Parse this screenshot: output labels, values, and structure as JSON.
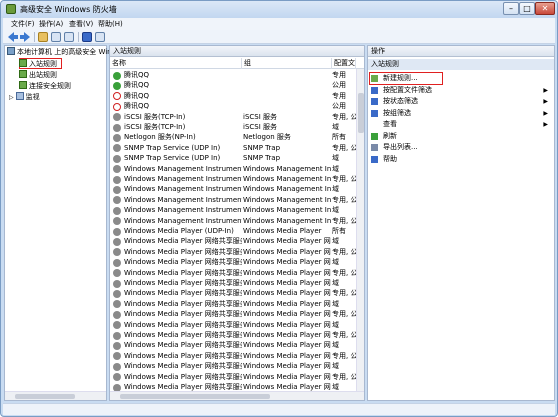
{
  "window": {
    "title": "高级安全 Windows 防火墙",
    "min": "–",
    "max": "□",
    "close": "✕"
  },
  "menu": [
    "文件(F)",
    "操作(A)",
    "查看(V)",
    "帮助(H)"
  ],
  "tree": {
    "root": "本地计算机 上的高级安全 Win",
    "items": [
      "入站规则",
      "出站规则",
      "连接安全规则",
      "监视"
    ]
  },
  "center": {
    "title": "入站规则",
    "columns": [
      "名称",
      "组",
      "配置文件"
    ],
    "rows": [
      {
        "icon": "allow",
        "name": "腾讯QQ",
        "group": "",
        "profile": "专用"
      },
      {
        "icon": "allow",
        "name": "腾讯QQ",
        "group": "",
        "profile": "公用"
      },
      {
        "icon": "block",
        "name": "腾讯QQ",
        "group": "",
        "profile": "专用"
      },
      {
        "icon": "block",
        "name": "腾讯QQ",
        "group": "",
        "profile": "公用"
      },
      {
        "icon": "gray",
        "name": "iSCSI 服务(TCP-In)",
        "group": "iSCSI 服务",
        "profile": "专用, 公"
      },
      {
        "icon": "gray",
        "name": "iSCSI 服务(TCP-In)",
        "group": "iSCSI 服务",
        "profile": "域"
      },
      {
        "icon": "gray",
        "name": "Netlogon 服务(NP-In)",
        "group": "Netlogon 服务",
        "profile": "所有"
      },
      {
        "icon": "gray",
        "name": "SNMP Trap Service (UDP In)",
        "group": "SNMP Trap",
        "profile": "专用, 公"
      },
      {
        "icon": "gray",
        "name": "SNMP Trap Service (UDP In)",
        "group": "SNMP Trap",
        "profile": "域"
      },
      {
        "icon": "gray",
        "name": "Windows Management Instrumentati...",
        "group": "Windows Management In...",
        "profile": "域"
      },
      {
        "icon": "gray",
        "name": "Windows Management Instrumentati...",
        "group": "Windows Management In...",
        "profile": "专用, 公"
      },
      {
        "icon": "gray",
        "name": "Windows Management Instrumentati...",
        "group": "Windows Management In...",
        "profile": "域"
      },
      {
        "icon": "gray",
        "name": "Windows Management Instrumentati...",
        "group": "Windows Management In...",
        "profile": "专用, 公"
      },
      {
        "icon": "gray",
        "name": "Windows Management Instrumentati...",
        "group": "Windows Management In...",
        "profile": "域"
      },
      {
        "icon": "gray",
        "name": "Windows Management Instrumentati...",
        "group": "Windows Management In...",
        "profile": "专用, 公"
      },
      {
        "icon": "gray",
        "name": "Windows Media Player (UDP-In)",
        "group": "Windows Media Player",
        "profile": "所有"
      },
      {
        "icon": "gray",
        "name": "Windows Media Player 网络共享服务(...",
        "group": "Windows Media Player 网...",
        "profile": "域"
      },
      {
        "icon": "gray",
        "name": "Windows Media Player 网络共享服务(...",
        "group": "Windows Media Player 网...",
        "profile": "专用, 公"
      },
      {
        "icon": "gray",
        "name": "Windows Media Player 网络共享服务(...",
        "group": "Windows Media Player 网...",
        "profile": "域"
      },
      {
        "icon": "gray",
        "name": "Windows Media Player 网络共享服务(...",
        "group": "Windows Media Player 网...",
        "profile": "专用, 公"
      },
      {
        "icon": "gray",
        "name": "Windows Media Player 网络共享服务(...",
        "group": "Windows Media Player 网...",
        "profile": "域"
      },
      {
        "icon": "gray",
        "name": "Windows Media Player 网络共享服务(...",
        "group": "Windows Media Player 网...",
        "profile": "专用, 公"
      },
      {
        "icon": "gray",
        "name": "Windows Media Player 网络共享服务(...",
        "group": "Windows Media Player 网...",
        "profile": "域"
      },
      {
        "icon": "gray",
        "name": "Windows Media Player 网络共享服务(...",
        "group": "Windows Media Player 网...",
        "profile": "专用, 公"
      },
      {
        "icon": "gray",
        "name": "Windows Media Player 网络共享服务(...",
        "group": "Windows Media Player 网...",
        "profile": "域"
      },
      {
        "icon": "gray",
        "name": "Windows Media Player 网络共享服务(...",
        "group": "Windows Media Player 网...",
        "profile": "专用, 公"
      },
      {
        "icon": "gray",
        "name": "Windows Media Player 网络共享服务(...",
        "group": "Windows Media Player 网...",
        "profile": "域"
      },
      {
        "icon": "gray",
        "name": "Windows Media Player 网络共享服务(...",
        "group": "Windows Media Player 网...",
        "profile": "专用, 公"
      },
      {
        "icon": "gray",
        "name": "Windows Media Player 网络共享服务(...",
        "group": "Windows Media Player 网...",
        "profile": "域"
      },
      {
        "icon": "gray",
        "name": "Windows Media Player 网络共享服务(...",
        "group": "Windows Media Player 网...",
        "profile": "专用, 公"
      },
      {
        "icon": "gray",
        "name": "Windows Media Player 网络共享服务(...",
        "group": "Windows Media Player 网...",
        "profile": "域"
      }
    ]
  },
  "actions": {
    "title": "操作",
    "section": "入站规则",
    "items": [
      {
        "label": "新建规则...",
        "icon": "new-rule-icon",
        "arrow": ""
      },
      {
        "label": "按配置文件筛选",
        "icon": "filter-icon",
        "arrow": "▶"
      },
      {
        "label": "按状态筛选",
        "icon": "filter-icon",
        "arrow": "▶"
      },
      {
        "label": "按组筛选",
        "icon": "filter-icon",
        "arrow": "▶"
      },
      {
        "label": "查看",
        "icon": "",
        "arrow": "▶"
      },
      {
        "label": "刷新",
        "icon": "refresh-icon",
        "arrow": ""
      },
      {
        "label": "导出列表...",
        "icon": "export-icon",
        "arrow": ""
      },
      {
        "label": "帮助",
        "icon": "help-icon",
        "arrow": ""
      }
    ]
  }
}
